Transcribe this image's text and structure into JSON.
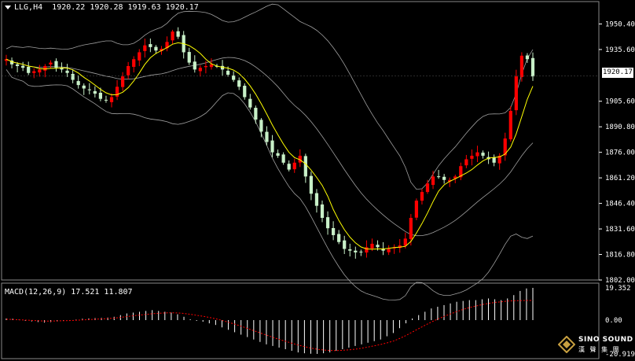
{
  "header": {
    "symbol": "LLG,H4",
    "ohlc": "1920.22 1920.28 1919.63 1920.17"
  },
  "current_price_label": "1920.17",
  "macd": {
    "label": "MACD(12,26,9) 17.521 11.807",
    "ticks": [
      "19.352",
      "0.00",
      "-20.919"
    ]
  },
  "logo": {
    "line1": "SINO SOUND",
    "line2": "漢 聲 集 團"
  },
  "colors": {
    "background": "#000000",
    "bull": "#ff0000",
    "bear": "#c8f0c8",
    "ma": "#ffff00",
    "bands": "#a0a0a0",
    "signal": "#ff0000",
    "histogram": "#ffffff"
  },
  "chart_data": {
    "type": "candlestick",
    "title": "LLG,H4",
    "ylim": [
      1802.0,
      1957.0
    ],
    "y_ticks": [
      1950.4,
      1935.6,
      1920.17,
      1905.6,
      1890.8,
      1876.0,
      1861.2,
      1846.4,
      1831.6,
      1816.8,
      1802.0
    ],
    "y_tick_labels": [
      "1950.40",
      "1935.60",
      "1920.17",
      "1905.60",
      "1890.80",
      "1876.00",
      "1861.20",
      "1846.40",
      "1831.60",
      "1816.80",
      "1802.00"
    ],
    "close_path": [
      1930,
      1927,
      1926,
      1925,
      1922,
      1923,
      1924,
      1926,
      1928,
      1925,
      1924,
      1922,
      1918,
      1915,
      1913,
      1912,
      1910,
      1907,
      1906,
      1908,
      1914,
      1920,
      1926,
      1930,
      1934,
      1938,
      1937,
      1935,
      1936,
      1940,
      1946,
      1943,
      1934,
      1928,
      1924,
      1925,
      1926,
      1927,
      1926,
      1924,
      1921,
      1918,
      1914,
      1908,
      1902,
      1895,
      1888,
      1882,
      1876,
      1874,
      1870,
      1866,
      1870,
      1874,
      1862,
      1852,
      1845,
      1838,
      1832,
      1828,
      1824,
      1820,
      1819,
      1818,
      1818,
      1821,
      1823,
      1821,
      1819,
      1820,
      1821,
      1822,
      1826,
      1838,
      1848,
      1853,
      1858,
      1862,
      1862,
      1860,
      1860,
      1862,
      1868,
      1872,
      1874,
      1876,
      1874,
      1872,
      1870,
      1874,
      1884,
      1900,
      1920,
      1932,
      1930,
      1920
    ],
    "macd_hist": [
      1.0,
      0.8,
      0.3,
      -0.5,
      -0.8,
      -1.2,
      -1.5,
      -1.2,
      -0.8,
      -0.5,
      -0.2,
      0.3,
      0.8,
      1.0,
      1.2,
      1.3,
      1.5,
      2.0,
      3.0,
      4.0,
      4.5,
      5.0,
      5.5,
      6.0,
      5.5,
      5.0,
      4.5,
      3.5,
      2.0,
      0.5,
      -0.5,
      -1.0,
      -2.0,
      -3.0,
      -4.5,
      -6.0,
      -7.5,
      -9.0,
      -10.5,
      -12.0,
      -13.5,
      -15.0,
      -16.0,
      -17.0,
      -18.0,
      -19.0,
      -20.0,
      -20.5,
      -20.8,
      -20.9,
      -20.5,
      -20.0,
      -19.0,
      -18.0,
      -17.0,
      -16.0,
      -15.0,
      -14.0,
      -13.0,
      -12.0,
      -10.0,
      -8.0,
      -5.0,
      -2.0,
      1.0,
      3.0,
      5.0,
      7.0,
      8.0,
      9.0,
      10.0,
      11.0,
      11.5,
      12.0,
      12.0,
      12.5,
      13.0,
      12.5,
      12.0,
      13.0,
      15.0,
      17.5,
      19.0,
      19.352
    ],
    "macd_signal": [
      0.5,
      0.4,
      0.2,
      0.0,
      -0.2,
      -0.4,
      -0.6,
      -0.6,
      -0.5,
      -0.4,
      -0.3,
      -0.1,
      0.1,
      0.3,
      0.5,
      0.7,
      0.9,
      1.2,
      1.6,
      2.1,
      2.6,
      3.0,
      3.4,
      3.8,
      4.1,
      4.3,
      4.4,
      4.3,
      4.0,
      3.5,
      2.9,
      2.3,
      1.6,
      0.8,
      -0.2,
      -1.3,
      -2.5,
      -3.8,
      -5.1,
      -6.5,
      -7.9,
      -9.3,
      -10.6,
      -11.9,
      -13.1,
      -14.3,
      -15.4,
      -16.4,
      -17.3,
      -18.0,
      -18.5,
      -18.8,
      -18.9,
      -18.7,
      -18.4,
      -18.0,
      -17.4,
      -16.7,
      -15.9,
      -15.1,
      -14.1,
      -13.0,
      -11.4,
      -9.5,
      -7.4,
      -5.3,
      -3.2,
      -1.2,
      0.6,
      2.2,
      3.7,
      5.1,
      6.4,
      7.5,
      8.4,
      9.3,
      10.0,
      10.6,
      11.0,
      11.4,
      11.6,
      11.7,
      11.8,
      11.807
    ]
  }
}
